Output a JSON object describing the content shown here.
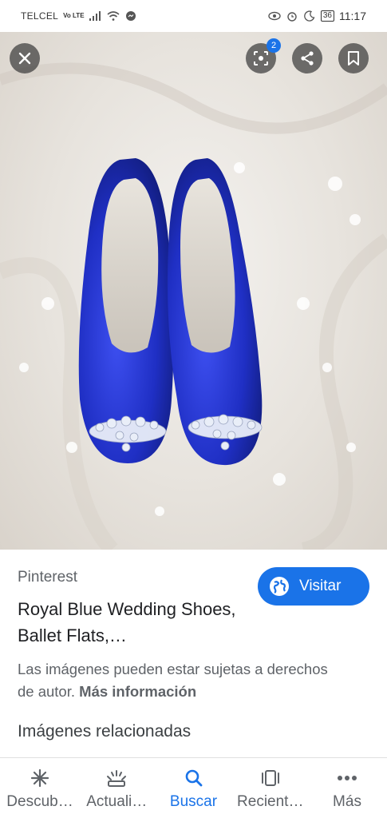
{
  "status_bar": {
    "carrier": "TELCEL",
    "network_badge": "Vo LTE",
    "battery": "36",
    "time": "11:17"
  },
  "viewer": {
    "close_icon": "close-icon",
    "lens_badge_count": "2",
    "lens_icon": "lens-icon",
    "share_icon": "share-icon",
    "bookmark_icon": "bookmark-icon"
  },
  "result": {
    "source": "Pinterest",
    "title": "Royal Blue Wedding Shoes, Ballet Flats,…",
    "visit_label": "Visitar",
    "notice_text": "Las imágenes pueden estar sujetas a derechos de autor.",
    "notice_link": "Más información",
    "related_heading": "Imágenes relacionadas"
  },
  "bottom_nav": {
    "items": [
      {
        "label": "Descub…",
        "icon": "asterisk-icon",
        "active": false
      },
      {
        "label": "Actuali…",
        "icon": "updates-icon",
        "active": false
      },
      {
        "label": "Buscar",
        "icon": "search-icon",
        "active": true
      },
      {
        "label": "Recient…",
        "icon": "recent-tabs-icon",
        "active": false
      },
      {
        "label": "Más",
        "icon": "more-icon",
        "active": false
      }
    ]
  },
  "colors": {
    "accent": "#1a73e8",
    "shoe_blue": "#1f2fc4"
  }
}
